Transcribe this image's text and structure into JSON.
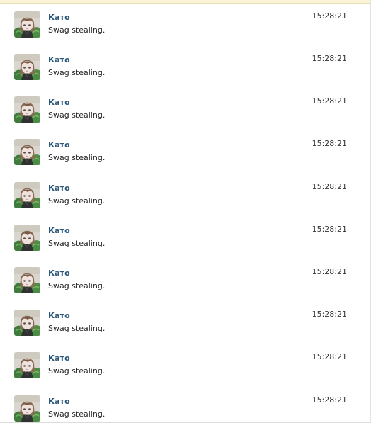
{
  "messages": [
    {
      "author": "Като",
      "text": "Swag stealing.",
      "time": "15:28:21"
    },
    {
      "author": "Като",
      "text": "Swag stealing.",
      "time": "15:28:21"
    },
    {
      "author": "Като",
      "text": "Swag stealing.",
      "time": "15:28:21"
    },
    {
      "author": "Като",
      "text": "Swag stealing.",
      "time": "15:28:21"
    },
    {
      "author": "Като",
      "text": "Swag stealing.",
      "time": "15:28:21"
    },
    {
      "author": "Като",
      "text": "Swag stealing.",
      "time": "15:28:21"
    },
    {
      "author": "Като",
      "text": "Swag stealing.",
      "time": "15:28:21"
    },
    {
      "author": "Като",
      "text": "Swag stealing.",
      "time": "15:28:21"
    },
    {
      "author": "Като",
      "text": "Swag stealing.",
      "time": "15:28:21"
    },
    {
      "author": "Като",
      "text": "Swag stealing.",
      "time": "15:28:21"
    }
  ],
  "colors": {
    "author": "#2b587a",
    "text": "#222222",
    "time": "#333333"
  },
  "icons": {
    "avatar": "avatar-anime-girl-icon"
  }
}
